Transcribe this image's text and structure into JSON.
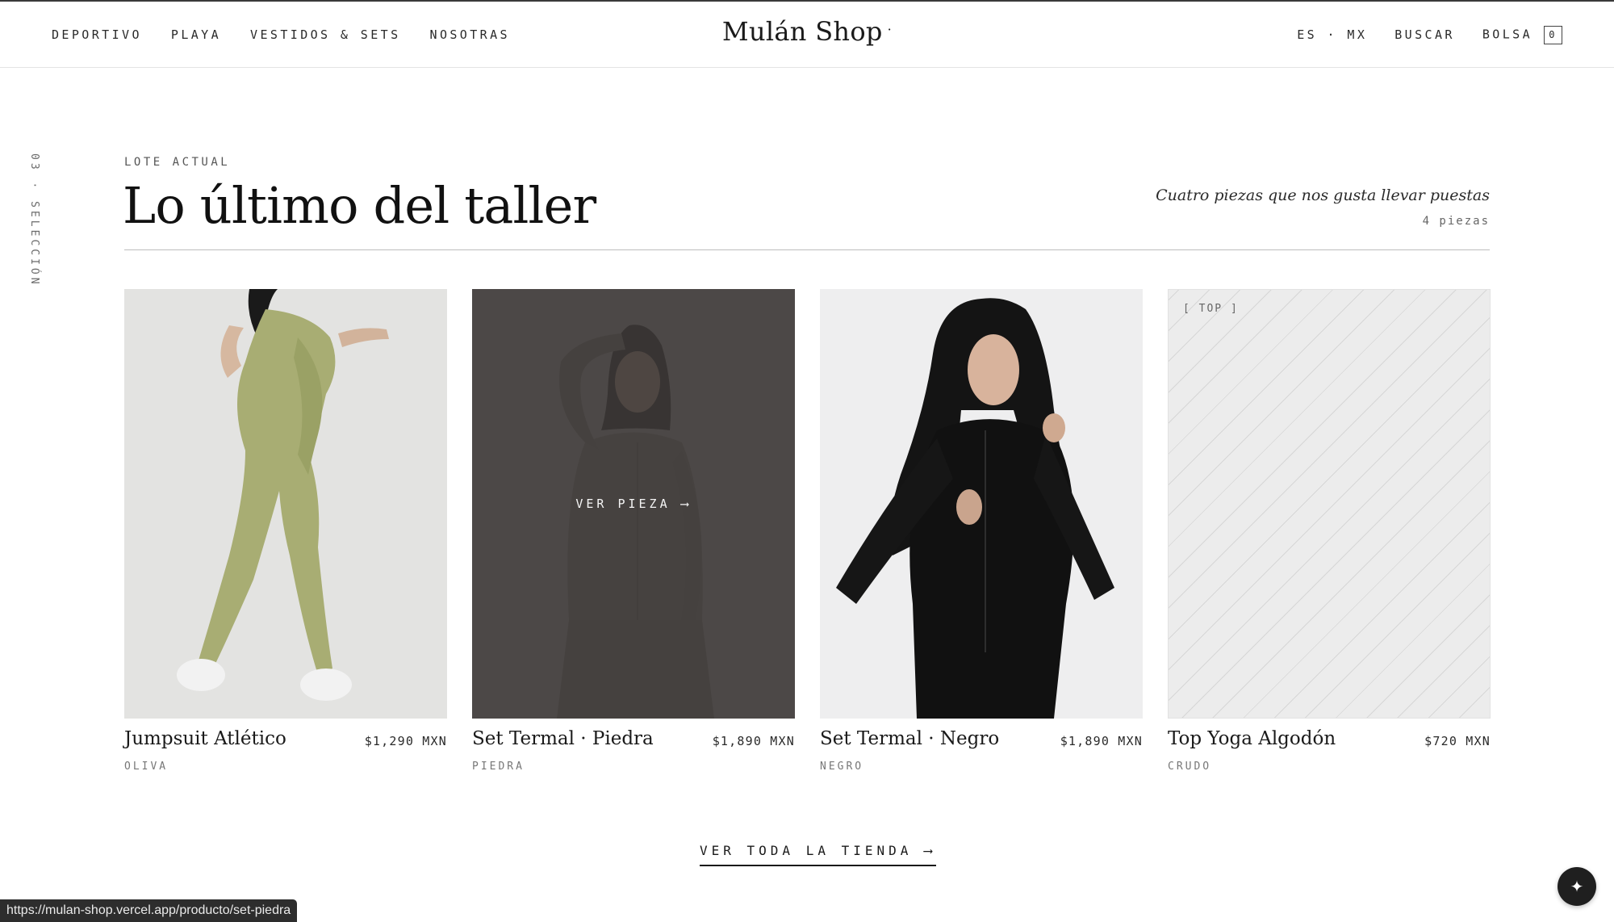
{
  "header": {
    "nav_left": [
      "DEPORTIVO",
      "PLAYA",
      "VESTIDOS & SETS",
      "NOSOTRAS"
    ],
    "brand": "Mulán Shop",
    "brand_mark": "·",
    "locale": "ES · MX",
    "search": "BUSCAR",
    "bag": "BOLSA",
    "bag_count": "0"
  },
  "side_label": "03 · SELECCIÓN",
  "section": {
    "eyebrow": "LOTE ACTUAL",
    "title": "Lo último del taller",
    "tagline": "Cuatro piezas que nos gusta llevar puestas",
    "count": "4 piezas"
  },
  "products": [
    {
      "name": "Jumpsuit Atlético",
      "price": "$1,290 MXN",
      "color": "OLIVA",
      "image": "model-olive-jumpsuit"
    },
    {
      "name": "Set Termal · Piedra",
      "price": "$1,890 MXN",
      "color": "PIEDRA",
      "image": "model-stone-set",
      "hover_cta": "VER PIEZA ⟶"
    },
    {
      "name": "Set Termal · Negro",
      "price": "$1,890 MXN",
      "color": "NEGRO",
      "image": "model-black-set"
    },
    {
      "name": "Top Yoga Algodón",
      "price": "$720 MXN",
      "color": "CRUDO",
      "image": "placeholder",
      "placeholder_tag": "[ TOP ]"
    }
  ],
  "cta": {
    "view_all": "VER TODA LA TIENDA ⟶"
  },
  "status_bar": {
    "url": "https://mulan-shop.vercel.app/producto/set-piedra"
  },
  "fab": {
    "icon": "sparkle-icon",
    "glyph": "✦"
  }
}
